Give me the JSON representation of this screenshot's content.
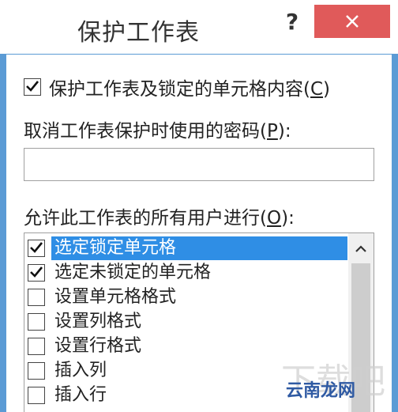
{
  "dialog": {
    "title": "保护工作表",
    "help_label": "?",
    "protect_checkbox": {
      "label": "保护工作表及锁定的单元格内容",
      "hotkey": "C",
      "checked": true
    },
    "password_label": "取消工作表保护时使用的密码",
    "password_hotkey": "P",
    "password_value": "",
    "allow_label": "允许此工作表的所有用户进行",
    "allow_hotkey": "O",
    "permissions": [
      {
        "label": "选定锁定单元格",
        "checked": true,
        "selected": true
      },
      {
        "label": "选定未锁定的单元格",
        "checked": true,
        "selected": false
      },
      {
        "label": "设置单元格格式",
        "checked": false,
        "selected": false
      },
      {
        "label": "设置列格式",
        "checked": false,
        "selected": false
      },
      {
        "label": "设置行格式",
        "checked": false,
        "selected": false
      },
      {
        "label": "插入列",
        "checked": false,
        "selected": false
      },
      {
        "label": "插入行",
        "checked": false,
        "selected": false
      }
    ]
  },
  "watermark": {
    "text": "云南龙网",
    "bg_text": "下载吧"
  },
  "colors": {
    "frame": "#5b9bd5",
    "close": "#e05a5a",
    "selection": "#2f8ee5"
  },
  "icons": {
    "help": "question-mark",
    "close": "close-x",
    "check": "checkmark",
    "scroll_up": "chevron-up"
  }
}
